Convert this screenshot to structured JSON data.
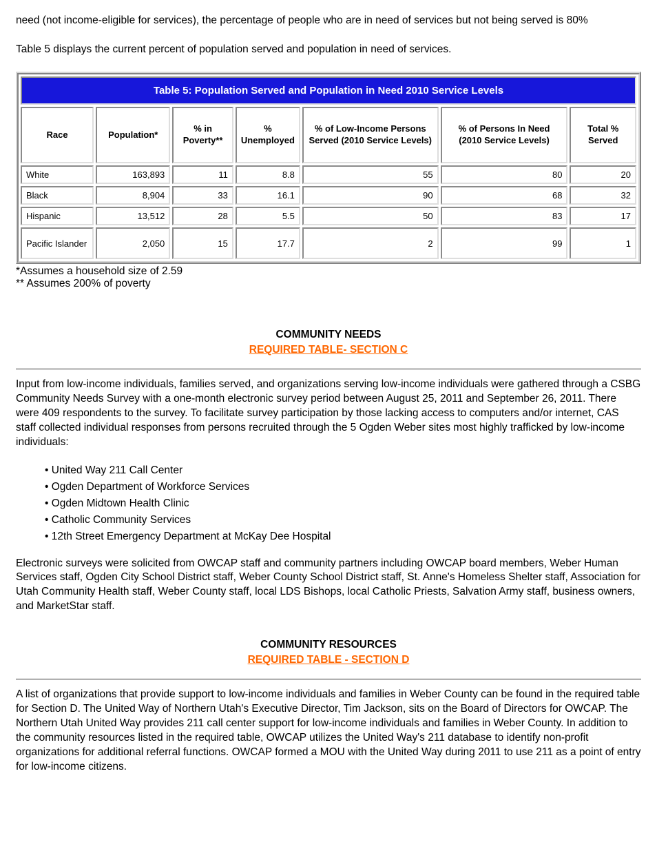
{
  "intro_paragraph": "need (not income-eligible for services), the percentage of people who are in need of services but not being served is 80%",
  "table_intro": "Table 5 displays the current percent of population served and population in need of services.",
  "table": {
    "title": "Table 5: Population Served and Population in Need 2010 Service Levels",
    "headers": {
      "race": "Race",
      "population": "Population*",
      "poverty": "% in Poverty**",
      "unemployed": "% Unemployed",
      "served_2010": "% of Low-Income Persons Served (2010 Service Levels)",
      "in_need": "% of Persons In Need (2010 Service Levels)",
      "served": "Total % Served"
    },
    "rows": [
      {
        "race": "White",
        "population": "163,893",
        "poverty": "11",
        "unemployed": "8.8",
        "served_2010": "55",
        "in_need": "80",
        "served": "20"
      },
      {
        "race": "Black",
        "population": "8,904",
        "poverty": "33",
        "unemployed": "16.1",
        "served_2010": "90",
        "in_need": "68",
        "served": "32"
      },
      {
        "race": "Hispanic",
        "population": "13,512",
        "poverty": "28",
        "unemployed": "5.5",
        "served_2010": "50",
        "in_need": "83",
        "served": "17"
      },
      {
        "race": "Pacific Islander",
        "population": "2,050",
        "poverty": "15",
        "unemployed": "17.7",
        "served_2010": "2",
        "in_need": "99",
        "served": "1"
      }
    ],
    "footnotes": {
      "star": "*Assumes a household size of 2.59",
      "dstar": "** Assumes 200% of poverty"
    }
  },
  "community_needs": {
    "heading": "COMMUNITY NEEDS",
    "link_text": "REQUIRED TABLE- SECTION C",
    "para1": "Input from low-income individuals, families served, and organizations serving low-income individuals were gathered through a CSBG Community Needs Survey with a one-month electronic survey period between August 25, 2011 and September 26, 2011. There were 409 respondents to the survey. To facilitate survey participation by those lacking access to computers and/or internet, CAS staff collected individual responses from persons recruited through the 5 Ogden Weber sites most highly trafficked by low-income individuals:",
    "sites": [
      "• United Way 211 Call Center",
      "• Ogden Department of Workforce Services",
      "• Ogden Midtown Health Clinic",
      "• Catholic Community Services",
      "• 12th Street Emergency Department at McKay Dee Hospital"
    ],
    "para2": "Electronic surveys were solicited from OWCAP staff and community partners including OWCAP board members, Weber Human Services staff, Ogden City School District staff, Weber County School District staff, St. Anne's Homeless Shelter staff, Association for Utah Community Health staff, Weber County staff, local LDS Bishops, local Catholic Priests, Salvation Army staff, business owners, and MarketStar staff.",
    "heading2": "COMMUNITY RESOURCES",
    "link_text2": "REQUIRED TABLE - SECTION D",
    "para3": "A list of organizations that provide support to low-income individuals and families in Weber County can be found in the required table for Section D. The United Way of Northern Utah's Executive Director, Tim Jackson, sits on the Board of Directors for OWCAP. The Northern Utah United Way provides 211 call center support for low-income individuals and families in Weber County. In addition to the community resources listed in the required table, OWCAP utilizes the United Way's 211 database to identify non-profit organizations for additional referral functions. OWCAP formed a MOU with the United Way during 2011 to use 211 as a point of entry for low-income citizens."
  }
}
